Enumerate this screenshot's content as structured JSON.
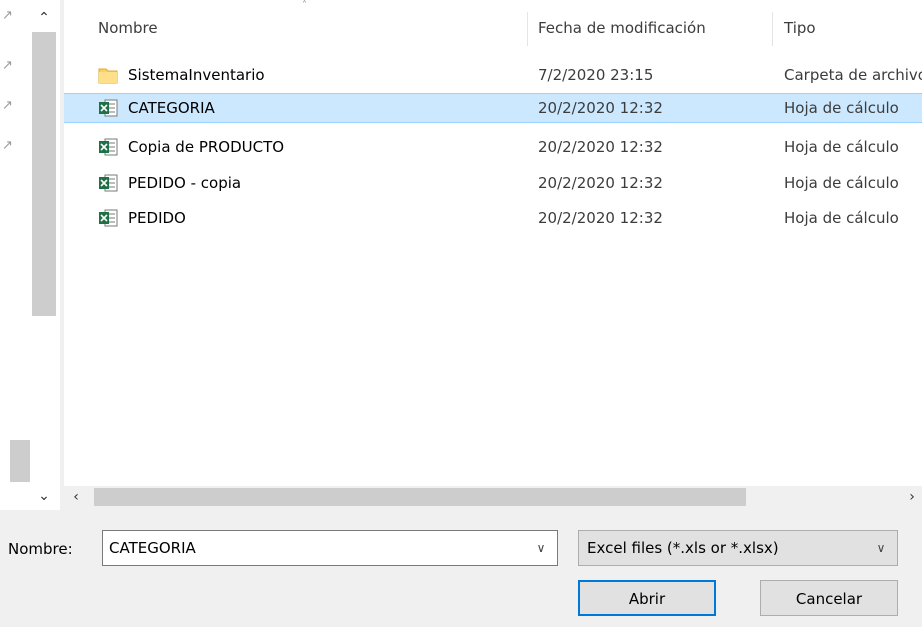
{
  "columns": {
    "name": "Nombre",
    "date": "Fecha de modificación",
    "type": "Tipo"
  },
  "files": [
    {
      "name": "SistemaInventario",
      "date": "7/2/2020 23:15",
      "type": "Carpeta de archivos",
      "icon": "folder-icon",
      "selected": false
    },
    {
      "name": "CATEGORIA",
      "date": "20/2/2020 12:32",
      "type": "Hoja de cálculo",
      "icon": "excel-icon",
      "selected": true
    },
    {
      "name": "Copia de PRODUCTO",
      "date": "20/2/2020 12:32",
      "type": "Hoja de cálculo",
      "icon": "excel-icon",
      "selected": false
    },
    {
      "name": "PEDIDO - copia",
      "date": "20/2/2020 12:32",
      "type": "Hoja de cálculo",
      "icon": "excel-icon",
      "selected": false
    },
    {
      "name": "PEDIDO",
      "date": "20/2/2020 12:32",
      "type": "Hoja de cálculo",
      "icon": "excel-icon",
      "selected": false
    }
  ],
  "filename": {
    "label": "Nombre:",
    "value": "CATEGORIA"
  },
  "filter": {
    "value": "Excel files (*.xls or *.xlsx)"
  },
  "buttons": {
    "open": "Abrir",
    "cancel": "Cancelar"
  },
  "colors": {
    "selection_bg": "#cce8ff",
    "selection_border": "#99d1ff",
    "folder": "#ffd15c",
    "excel": "#1e7145",
    "default_button_border": "#0078d7"
  }
}
